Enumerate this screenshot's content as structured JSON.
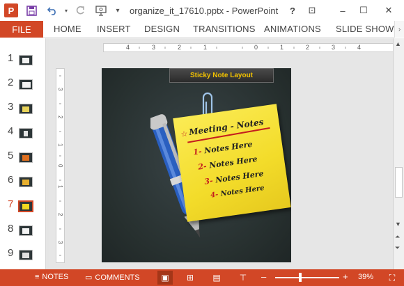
{
  "window": {
    "title": "organize_it_17610.pptx - PowerPoint",
    "app_logo": "P",
    "controls": {
      "help": "?",
      "ribbon_options": "⊡",
      "minimize": "–",
      "maximize": "☐",
      "close": "✕"
    }
  },
  "quick_access": {
    "save_icon": "save-icon",
    "undo_icon": "undo-icon",
    "redo_icon": "redo-icon",
    "present_icon": "present-icon",
    "customize_icon": "dropdown-icon"
  },
  "ribbon": {
    "file": "FILE",
    "tabs": [
      "HOME",
      "INSERT",
      "DESIGN",
      "TRANSITIONS",
      "ANIMATIONS",
      "SLIDE SHOW"
    ],
    "more": "›"
  },
  "thumbnails": {
    "items": [
      {
        "num": "1",
        "selected": false
      },
      {
        "num": "2",
        "selected": false
      },
      {
        "num": "3",
        "selected": false
      },
      {
        "num": "4",
        "selected": false
      },
      {
        "num": "5",
        "selected": false
      },
      {
        "num": "6",
        "selected": false
      },
      {
        "num": "7",
        "selected": true
      },
      {
        "num": "8",
        "selected": false
      },
      {
        "num": "9",
        "selected": false
      }
    ]
  },
  "ruler": {
    "h_labels": [
      "4",
      "3",
      "2",
      "1",
      "0",
      "1",
      "2",
      "3",
      "4"
    ],
    "v_labels": [
      "3",
      "2",
      "1",
      "0",
      "1",
      "2",
      "3"
    ]
  },
  "slide": {
    "banner": "Sticky Note Layout",
    "note": {
      "heading": "Meeting - Notes",
      "items": [
        {
          "num": "1-",
          "text": "Notes Here"
        },
        {
          "num": "2-",
          "text": "Notes Here"
        },
        {
          "num": "3-",
          "text": "Notes Here"
        },
        {
          "num": "4-",
          "text": "Notes Here"
        }
      ]
    },
    "colors": {
      "background": "#2a3436",
      "note": "#f5e033",
      "pen": "#2a5fc0",
      "heading_underline": "#c41e1e"
    }
  },
  "statusbar": {
    "notes": "NOTES",
    "comments": "COMMENTS",
    "zoom_minus": "–",
    "zoom_plus": "+",
    "zoom": "39%",
    "zoom_fraction": 0.39
  }
}
